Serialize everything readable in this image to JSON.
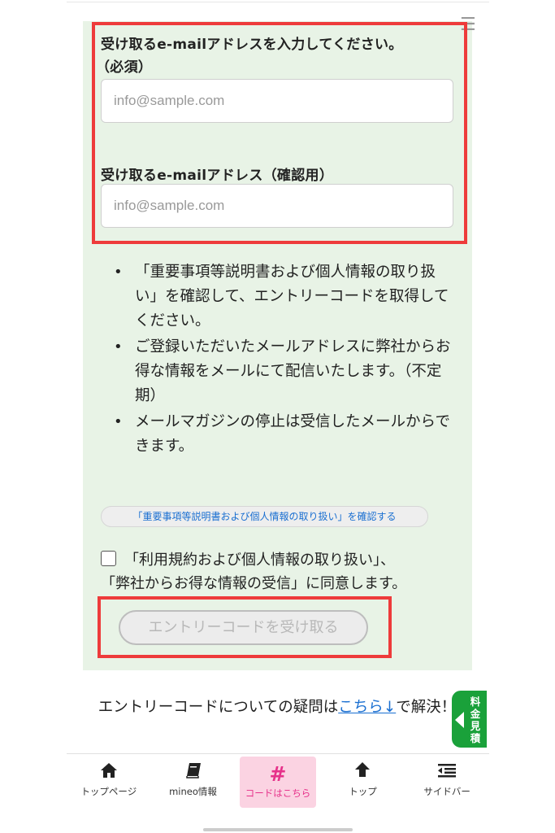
{
  "form": {
    "email_label": "受け取るe-mailアドレスを入力してください。",
    "required_label": "（必須）",
    "email_placeholder": "info@sample.com",
    "confirm_label": "受け取るe-mailアドレス（確認用）",
    "confirm_placeholder": "info@sample.com"
  },
  "notes": [
    "「重要事項等説明書および個人情報の取り扱い」を確認して、エントリーコードを取得してください。",
    "ご登録いただいたメールアドレスに弊社からお得な情報をメールにて配信いたします。（不定期）",
    "メールマガジンの停止は受信したメールからできます。"
  ],
  "doc_link": "「重要事項等説明書および個人情報の取り扱い」を確認する",
  "agreement": {
    "line1": "「利用規約および個人情報の取り扱い」、",
    "line2": "「弊社からお得な情報の受信」に同意します。"
  },
  "get_code_button": "エントリーコードを受け取る",
  "faq": {
    "prefix": "エントリーコードについての疑問は",
    "link": "こちら↓",
    "suffix": "で解決！"
  },
  "side_tab": {
    "label": "料金見積"
  },
  "bottom_nav": [
    {
      "icon": "home-icon",
      "label": "トップページ"
    },
    {
      "icon": "book-icon",
      "label": "mineo情報"
    },
    {
      "icon": "hash-icon",
      "label": "コードはこちら"
    },
    {
      "icon": "arrow-up-icon",
      "label": "トップ"
    },
    {
      "icon": "sidebar-menu-icon",
      "label": "サイドバー"
    }
  ],
  "colors": {
    "panel_bg": "#e8f3e6",
    "highlight_border": "#ee3b3b",
    "link": "#1a6fd1",
    "active_nav_bg": "#fbd3e2",
    "active_nav_text": "#e6318a",
    "side_tab_bg": "#1aa13a"
  }
}
